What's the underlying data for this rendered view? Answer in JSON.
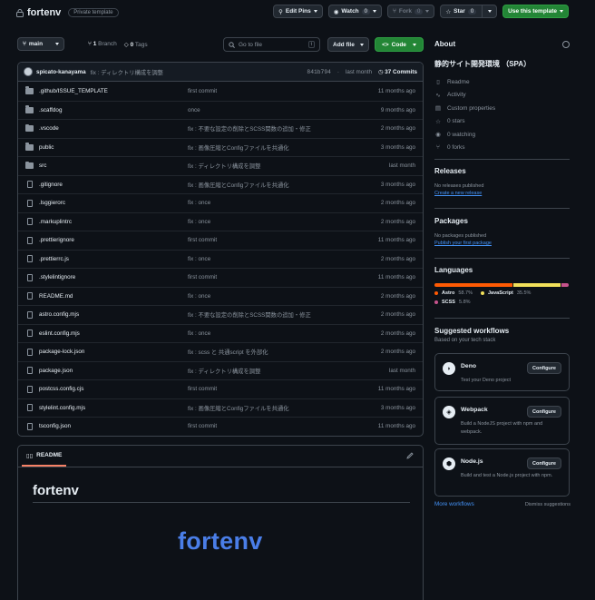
{
  "repo": {
    "name": "fortenv",
    "visibility": "Private template"
  },
  "header_actions": {
    "edit_pins": "Edit Pins",
    "watch": "Watch",
    "watch_count": "0",
    "fork": "Fork",
    "fork_count": "0",
    "star": "Star",
    "star_count": "0",
    "use_template": "Use this template"
  },
  "toolbar": {
    "branch": "main",
    "branch_count": "1",
    "branch_label": "Branch",
    "tag_count": "0",
    "tag_label": "Tags",
    "search_placeholder": "Go to file",
    "search_key": "t",
    "add_file": "Add file",
    "code": "Code"
  },
  "latest_commit": {
    "user": "spicato-kanayama",
    "message": "fix : ディレクトリ構成を調整",
    "hash": "841b794",
    "sep": "·",
    "when": "last month",
    "count": "37 Commits"
  },
  "files": [
    {
      "type": "folder",
      "name": ".github/ISSUE_TEMPLATE",
      "message": "first commit",
      "date": "11 months ago"
    },
    {
      "type": "folder",
      "name": ".scaffdog",
      "message": "once",
      "date": "9 months ago"
    },
    {
      "type": "folder",
      "name": ".vscode",
      "message": "fix : 不要な設定の削除とSCSS関数の追加・修正",
      "date": "2 months ago"
    },
    {
      "type": "folder",
      "name": "public",
      "message": "fix : 画像圧縮とConfigファイルを共通化",
      "date": "3 months ago"
    },
    {
      "type": "folder",
      "name": "src",
      "message": "fix : ディレクトリ構成を調整",
      "date": "last month"
    },
    {
      "type": "file",
      "name": ".gitignore",
      "message": "fix : 画像圧縮とConfigファイルを共通化",
      "date": "3 months ago"
    },
    {
      "type": "file",
      "name": ".lsggierorc",
      "message": "fix : once",
      "date": "2 months ago"
    },
    {
      "type": "file",
      "name": ".markuplintrc",
      "message": "fix : once",
      "date": "2 months ago"
    },
    {
      "type": "file",
      "name": ".prettierignore",
      "message": "first commit",
      "date": "11 months ago"
    },
    {
      "type": "file",
      "name": ".prettierrc.js",
      "message": "fix : once",
      "date": "2 months ago"
    },
    {
      "type": "file",
      "name": ".stylelintignore",
      "message": "first commit",
      "date": "11 months ago"
    },
    {
      "type": "file",
      "name": "README.md",
      "message": "fix : once",
      "date": "2 months ago"
    },
    {
      "type": "file",
      "name": "astro.config.mjs",
      "message": "fix : 不要な設定の削除とSCSS関数の追加・修正",
      "date": "2 months ago"
    },
    {
      "type": "file",
      "name": "eslint.config.mjs",
      "message": "fix : once",
      "date": "2 months ago"
    },
    {
      "type": "file",
      "name": "package-lock.json",
      "message": "fix : scss と 共通script を外部化",
      "date": "2 months ago"
    },
    {
      "type": "file",
      "name": "package.json",
      "message": "fix : ディレクトリ構成を調整",
      "date": "last month"
    },
    {
      "type": "file",
      "name": "postcss.config.cjs",
      "message": "first commit",
      "date": "11 months ago"
    },
    {
      "type": "file",
      "name": "stylelint.config.mjs",
      "message": "fix : 画像圧縮とConfigファイルを共通化",
      "date": "3 months ago"
    },
    {
      "type": "file",
      "name": "tsconfig.json",
      "message": "first commit",
      "date": "11 months ago"
    }
  ],
  "readme": {
    "tab": "README",
    "heading": "fortenv",
    "logo_text": "fortenv"
  },
  "about": {
    "title": "About",
    "description": "静的サイト開発環境 （SPA）",
    "items": [
      "Readme",
      "Activity",
      "Custom properties",
      "0 stars",
      "0 watching",
      "0 forks"
    ]
  },
  "releases": {
    "title": "Releases",
    "empty": "No releases published",
    "link": "Create a new release"
  },
  "packages": {
    "title": "Packages",
    "empty": "No packages published",
    "link": "Publish your first package"
  },
  "languages": {
    "title": "Languages",
    "items": [
      {
        "name": "Astro",
        "percent": "58.7%",
        "value": 58.7,
        "color": "#ff5a03"
      },
      {
        "name": "JavaScript",
        "percent": "35.5%",
        "value": 35.5,
        "color": "#f1e05a"
      },
      {
        "name": "SCSS",
        "percent": "5.8%",
        "value": 5.8,
        "color": "#c6538c"
      }
    ]
  },
  "workflows": {
    "title": "Suggested workflows",
    "subtitle": "Based on your tech stack",
    "items": [
      {
        "name": "Deno",
        "desc": "Test your Deno project",
        "button": "Configure"
      },
      {
        "name": "Webpack",
        "desc": "Build a NodeJS project with npm and webpack.",
        "button": "Configure"
      },
      {
        "name": "Node.js",
        "desc": "Build and test a Node.js project with npm.",
        "button": "Configure"
      }
    ],
    "more": "More workflows",
    "dismiss": "Dismiss suggestions"
  }
}
